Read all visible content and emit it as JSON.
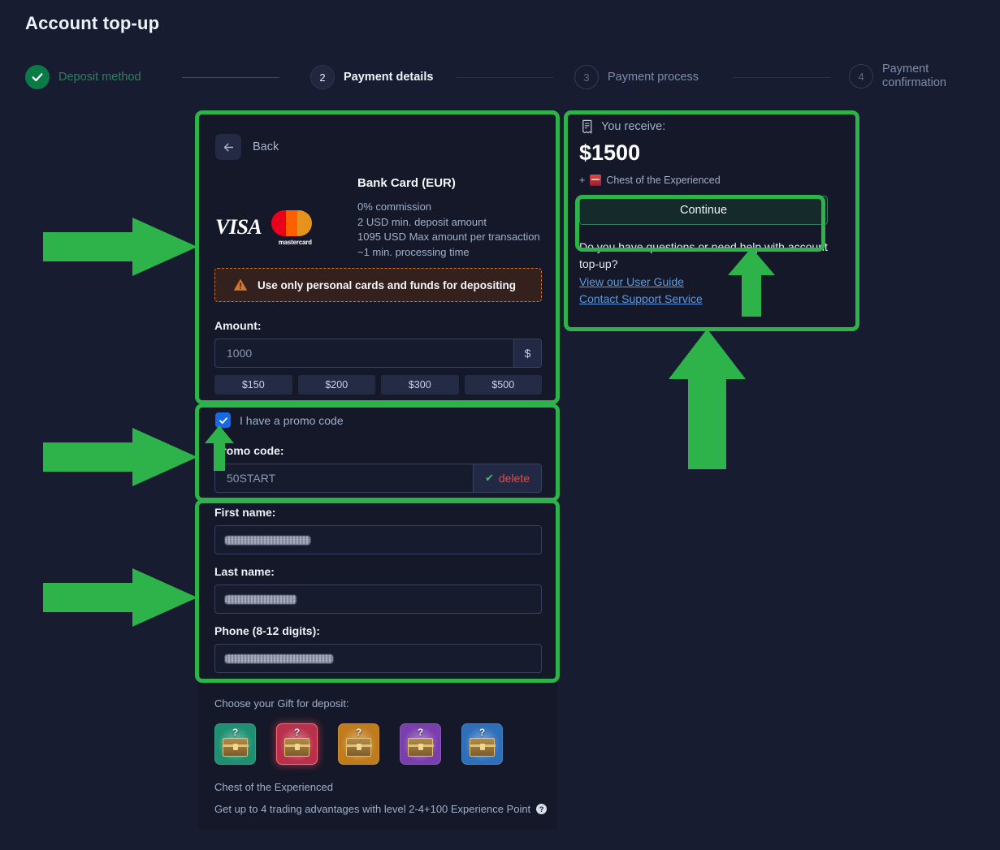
{
  "page": {
    "title": "Account top-up"
  },
  "stepper": {
    "steps": [
      {
        "num": "1",
        "label": "Deposit method",
        "state": "done"
      },
      {
        "num": "2",
        "label": "Payment details",
        "state": "current"
      },
      {
        "num": "3",
        "label": "Payment process",
        "state": "future"
      },
      {
        "num": "4",
        "label": "Payment\nconfirmation",
        "state": "future"
      }
    ]
  },
  "method": {
    "back_label": "Back",
    "brands": {
      "visa": "VISA",
      "mastercard": "mastercard"
    },
    "card_title": "Bank Card (EUR)",
    "details": [
      "0% commission",
      "2 USD min. deposit amount",
      "1095 USD Max amount per transaction",
      "~1 min. processing time"
    ],
    "warning": "Use only personal cards and funds for depositing",
    "amount_label": "Amount:",
    "amount_value": "1000",
    "currency_suffix": "$",
    "quick_amounts": [
      "$150",
      "$200",
      "$300",
      "$500"
    ]
  },
  "promo": {
    "checkbox_label": "I have a promo code",
    "checkbox_checked": true,
    "field_label": "Promo code:",
    "value": "50START",
    "delete_label": "delete",
    "delete_tick": "✔"
  },
  "identity": {
    "first_name_label": "First name:",
    "first_name_value": "",
    "last_name_label": "Last name:",
    "last_name_value": "",
    "phone_label": "Phone (8-12 digits):",
    "phone_value": ""
  },
  "gift": {
    "title": "Choose your Gift for deposit:",
    "chests": [
      {
        "name": "green-chest",
        "color": "#1f8f72",
        "selected": false
      },
      {
        "name": "red-chest",
        "color": "#b8304a",
        "selected": true
      },
      {
        "name": "orange-chest",
        "color": "#c07c1c",
        "selected": false
      },
      {
        "name": "purple-chest",
        "color": "#7a3fad",
        "selected": false
      },
      {
        "name": "blue-chest",
        "color": "#2f6fba",
        "selected": false
      }
    ],
    "selected_name": "Chest of the Experienced",
    "selected_desc": "Get up to 4 trading advantages with level 2-4+100 Experience Point",
    "help_glyph": "?"
  },
  "summary": {
    "receive_label": "You receive:",
    "amount": "$1500",
    "bonus_prefix": "+",
    "bonus_label": "Chest of the Experienced",
    "continue_label": "Continue",
    "help_question": "Do you have questions or need help with account top-up?",
    "links": [
      "View our User Guide",
      "Contact Support Service"
    ]
  },
  "annotations": {
    "highlight_color": "#2eb34a",
    "arrow_color": "#2eb34a"
  }
}
